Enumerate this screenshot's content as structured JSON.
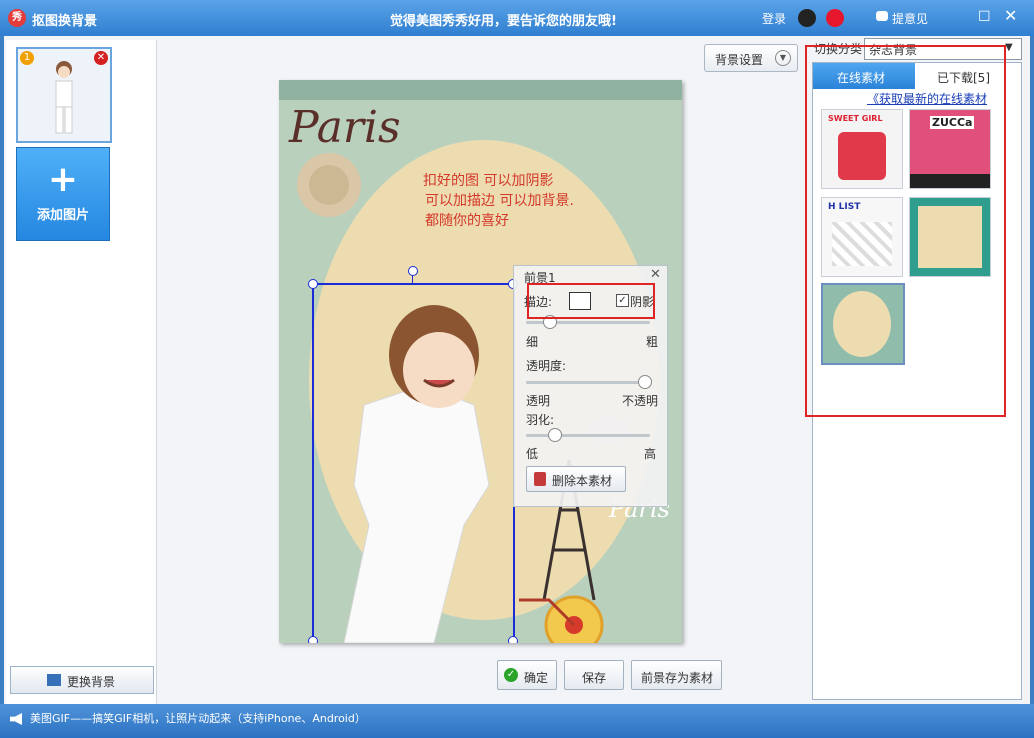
{
  "window": {
    "title": "抠图换背景",
    "slogan": "觉得美图秀秀好用，要告诉您的朋友哦!",
    "login": "登录",
    "feedback": "提意见",
    "app_icon_text": "秀"
  },
  "left": {
    "thumb_badge": "1",
    "add_plus": "+",
    "add_label": "添加图片",
    "change_bg": "更换背景"
  },
  "center": {
    "bg_settings": "背景设置",
    "canvas_text": [
      "扣好的图 可以加阴影",
      "可以加描边 可以加背景.",
      "都随你的喜好"
    ],
    "paris_logo": "Paris",
    "paris_small": "Paris",
    "buttons": {
      "ok": "确定",
      "save": "保存",
      "save_as": "前景存为素材"
    }
  },
  "fg_panel": {
    "title": "前景1",
    "stroke": "描边:",
    "shadow": "阴影",
    "shadow_checked": true,
    "thin": "细",
    "thick": "粗",
    "opacity": "透明度:",
    "transparent": "透明",
    "opaque": "不透明",
    "feather": "羽化:",
    "low": "低",
    "high": "高",
    "delete": "删除本素材",
    "stroke_level": 0.15,
    "opacity_level": 1.0,
    "feather_level": 0.2
  },
  "right": {
    "switch_label": "切换分类",
    "switch_value": "杂志背景",
    "tab_online": "在线素材",
    "tab_downloaded": "已下载[5]",
    "get_latest": "《获取最新的在线素材",
    "m1_text": "SWEET GIRL",
    "m2_text": "ZUCCa",
    "m3_text": "H LIST"
  },
  "status": {
    "text": "美图GIF——搞笑GIF相机，让照片动起来（支持iPhone、Android）"
  }
}
